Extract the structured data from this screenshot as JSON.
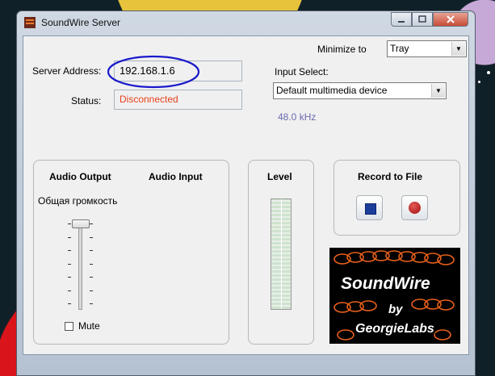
{
  "window": {
    "title": "SoundWire Server"
  },
  "server": {
    "address_label": "Server Address:",
    "address_value": "192.168.1.6",
    "status_label": "Status:",
    "status_value": "Disconnected",
    "status_color": "#e8401c"
  },
  "minimize": {
    "label": "Minimize to",
    "selected": "Tray"
  },
  "input": {
    "label": "Input Select:",
    "selected": "Default multimedia device",
    "rate": "48.0 kHz",
    "rate_color": "#6a6ab0"
  },
  "audio": {
    "output_label": "Audio Output",
    "input_label": "Audio Input",
    "volume_label": "Общая громкость",
    "volume_level": 1.0,
    "mute_label": "Mute",
    "mute_checked": false
  },
  "level": {
    "label": "Level"
  },
  "record": {
    "label": "Record to File"
  },
  "logo": {
    "title": "SoundWire",
    "by": "by",
    "author": "GeorgieLabs"
  },
  "annotation": {
    "color": "#1a1acc"
  },
  "icons": [
    "app-icon",
    "minimize-icon",
    "maximize-icon",
    "close-icon",
    "dropdown-arrow-icon",
    "stop-icon",
    "record-icon"
  ]
}
